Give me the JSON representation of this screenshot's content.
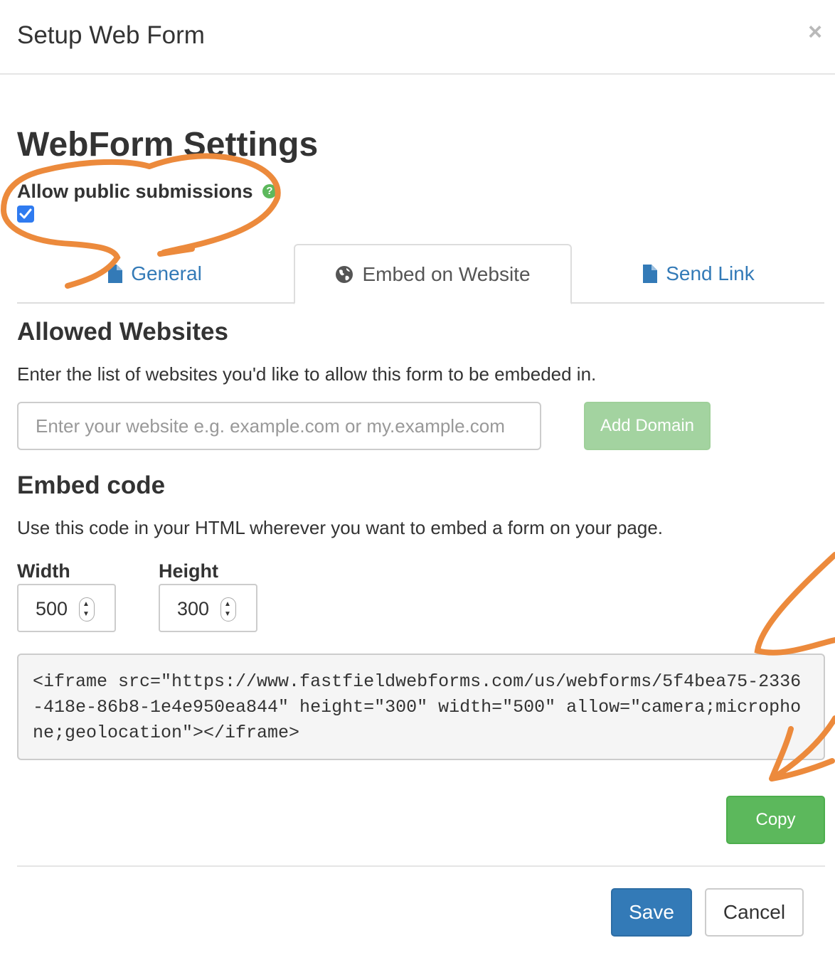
{
  "modal": {
    "title": "Setup Web Form",
    "close_symbol": "×"
  },
  "settings": {
    "heading": "WebForm Settings",
    "allow_public_label": "Allow public submissions",
    "allow_public_checked": true,
    "help_icon_symbol": "?"
  },
  "tabs": [
    {
      "label": "General",
      "icon": "file-icon",
      "active": false
    },
    {
      "label": "Embed on Website",
      "icon": "globe-icon",
      "active": true
    },
    {
      "label": "Send Link",
      "icon": "file-icon",
      "active": false
    }
  ],
  "allowed_websites": {
    "heading": "Allowed Websites",
    "description": "Enter the list of websites you'd like to allow this form to be embeded in.",
    "input_placeholder": "Enter your website e.g. example.com or my.example.com",
    "input_value": "",
    "add_button": "Add Domain"
  },
  "embed": {
    "heading": "Embed code",
    "description": "Use this code in your HTML wherever you want to embed a form on your page.",
    "width_label": "Width",
    "width_value": "500",
    "height_label": "Height",
    "height_value": "300",
    "code": "<iframe src=\"https://www.fastfieldwebforms.com/us/webforms/5f4bea75-2336-418e-86b8-1e4e950ea844\" height=\"300\" width=\"500\" allow=\"camera;microphone;geolocation\"></iframe>",
    "copy_button": "Copy"
  },
  "footer": {
    "save_button": "Save",
    "cancel_button": "Cancel"
  },
  "colors": {
    "primary": "#337ab7",
    "success": "#5cb85c",
    "success_disabled": "#a3d3a0",
    "checkbox": "#2f7bf0",
    "annotation": "#ec8a3c"
  }
}
